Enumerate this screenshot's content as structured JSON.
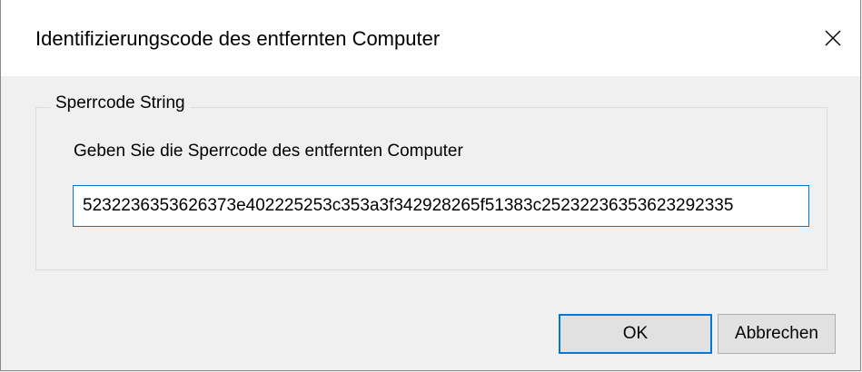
{
  "window": {
    "title": "Identifizierungscode des entfernten Computer"
  },
  "icons": {
    "close": "close-icon"
  },
  "group": {
    "legend": "Sperrcode String",
    "prompt": "Geben Sie die Sperrcode des entfernten Computer",
    "code_value": "5232236353626373e402225253c353a3f342928265f51383c25232236353623292335"
  },
  "buttons": {
    "ok_label": "OK",
    "cancel_label": "Abbrechen"
  },
  "colors": {
    "accent": "#0078d7",
    "dialog_bg": "#f0f0f0",
    "titlebar_bg": "#ffffff"
  }
}
